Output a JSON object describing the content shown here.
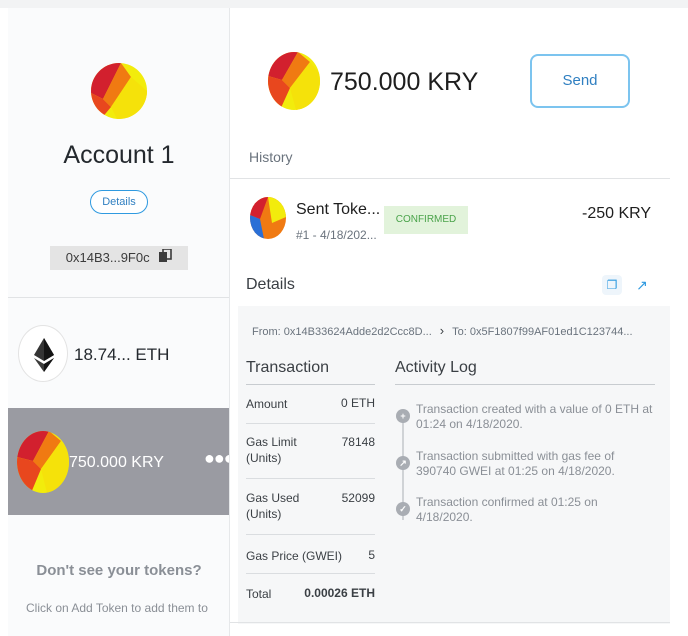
{
  "sidebar": {
    "account_name": "Account 1",
    "details_label": "Details",
    "address_short": "0x14B3...9F0c",
    "tokens": [
      {
        "amount": "18.74... ETH",
        "icon": "ethereum-icon"
      },
      {
        "amount": "750.000 KRY",
        "icon": "kry-token-icon",
        "selected": true
      }
    ],
    "dont_see_title": "Don't see your tokens?",
    "dont_see_hint": "Click on Add Token to add them to"
  },
  "header": {
    "balance": "750.000 KRY",
    "send_label": "Send"
  },
  "history": {
    "title": "History",
    "tx_title": "Sent Toke...",
    "tx_sub": "#1 - 4/18/202...",
    "tx_status": "CONFIRMED",
    "tx_value": "-250 KRY"
  },
  "details": {
    "title": "Details",
    "from": "From: 0x14B33624Adde2d2Ccc8D...",
    "to": "To: 0x5F1807f99AF01ed1C123744...",
    "transaction_title": "Transaction",
    "rows": [
      {
        "label": "Amount",
        "value": "0 ETH"
      },
      {
        "label": "Gas Limit (Units)",
        "value": "78148"
      },
      {
        "label": "Gas Used (Units)",
        "value": "52099"
      },
      {
        "label": "Gas Price (GWEI)",
        "value": "5"
      },
      {
        "label": "Total",
        "value": "0.00026 ETH"
      }
    ],
    "activity_title": "Activity Log",
    "activity": [
      "Transaction created with a value of 0 ETH at 01:24 on 4/18/2020.",
      "Transaction submitted with gas fee of 390740 GWEI at 01:25 on 4/18/2020.",
      "Transaction confirmed at 01:25 on 4/18/2020."
    ]
  },
  "colors": {
    "accent": "#2f9ae0",
    "confirmed_bg": "#e2f3db",
    "confirmed_text": "#4aa34a",
    "selected_row": "#9a9ba2"
  }
}
